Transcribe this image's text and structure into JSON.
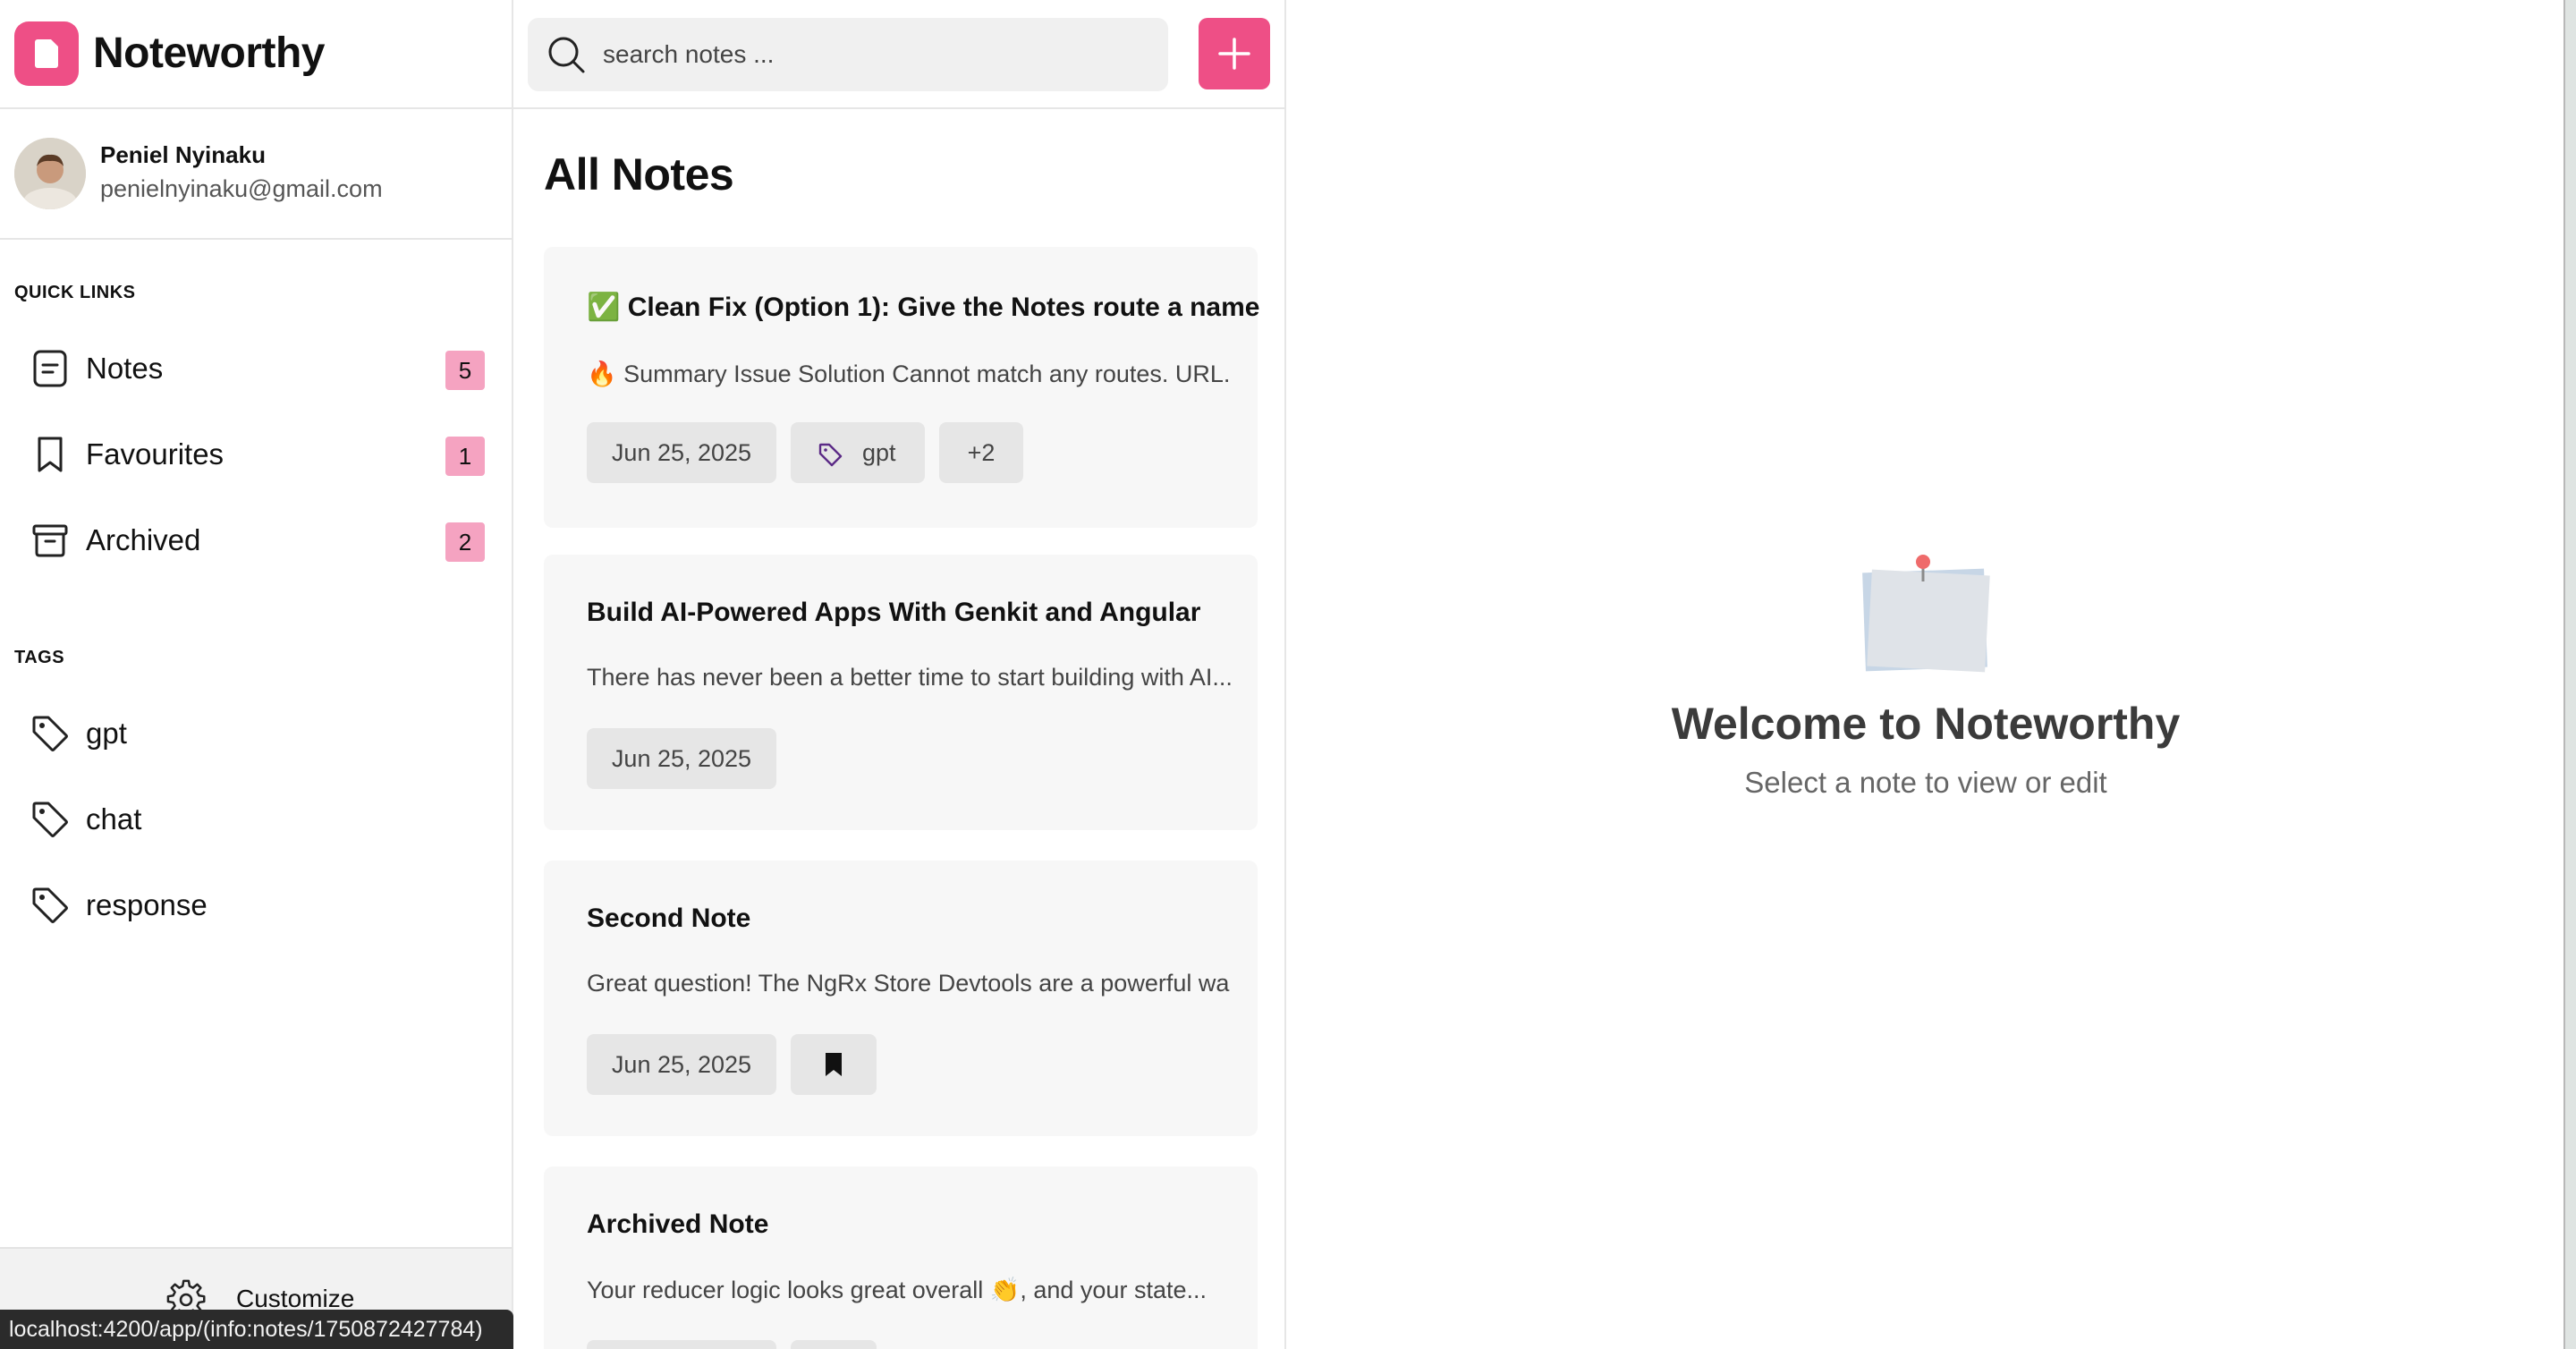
{
  "brand": {
    "name": "Noteworthy",
    "accent": "#ee4f86"
  },
  "profile": {
    "name": "Peniel Nyinaku",
    "email": "penielnyinaku@gmail.com"
  },
  "sidebar": {
    "quick_links_label": "QUICK LINKS",
    "quick_links": [
      {
        "label": "Notes",
        "count": "5",
        "icon": "note-icon"
      },
      {
        "label": "Favourites",
        "count": "1",
        "icon": "bookmark-icon"
      },
      {
        "label": "Archived",
        "count": "2",
        "icon": "archive-icon"
      }
    ],
    "tags_label": "TAGS",
    "tags": [
      {
        "label": "gpt",
        "icon": "tag-icon"
      },
      {
        "label": "chat",
        "icon": "tag-icon"
      },
      {
        "label": "response",
        "icon": "tag-icon"
      }
    ],
    "customize_label": "Customize"
  },
  "statusbar": {
    "url": "localhost:4200/app/(info:notes/1750872427784)"
  },
  "toolbar": {
    "search_placeholder": "search notes ...",
    "add_icon": "plus-icon"
  },
  "notes_list": {
    "title": "All Notes",
    "notes": [
      {
        "title": "✅ Clean Fix (Option 1): Give the Notes route a name",
        "excerpt": "🔥 Summary Issue Solution Cannot match any routes. URL...",
        "date": "Jun 25, 2025",
        "tag": "gpt",
        "more": "+2"
      },
      {
        "title": "Build AI-Powered Apps With Genkit and Angular",
        "excerpt": "There has never been a better time to start building with AI...",
        "date": "Jun 25, 2025"
      },
      {
        "title": "Second Note",
        "excerpt": "Great question! The NgRx Store Devtools are a powerful wa...",
        "date": "Jun 25, 2025",
        "favourite_icon": "bookmark-filled-icon"
      },
      {
        "title": "Archived Note",
        "excerpt": "Your reducer logic looks great overall 👏, and your state..."
      }
    ]
  },
  "detail": {
    "welcome_title": "Welcome to Noteworthy",
    "welcome_subtitle": "Select a note to view or edit",
    "illustration_icon": "pinned-note-icon"
  }
}
